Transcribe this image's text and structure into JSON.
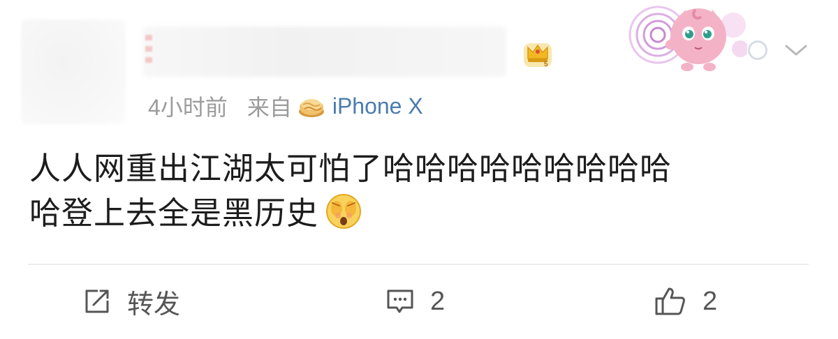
{
  "post": {
    "time": "4小时前",
    "from_label": "来自",
    "device": "iPhone X",
    "content_line1": "人人网重出江湖太可怕了哈哈哈哈哈哈哈哈哈",
    "content_line2": "哈登上去全是黑历史",
    "emoji": "scared-face-emoji"
  },
  "actions": {
    "repost_label": "转发",
    "comment_count": "2",
    "like_count": "2"
  },
  "colors": {
    "device_link": "#4a7cae",
    "meta_text": "#9b9b9b",
    "action_text": "#555555",
    "crown_gold": "#f2b824"
  },
  "icons": {
    "crown_badge": "crown-badge-icon",
    "decoration": "jigglypuff-decoration",
    "more": "more-circle-icon",
    "expand": "chevron-down-icon",
    "repost": "repost-icon",
    "comment": "comment-icon",
    "like": "thumbs-up-icon"
  }
}
